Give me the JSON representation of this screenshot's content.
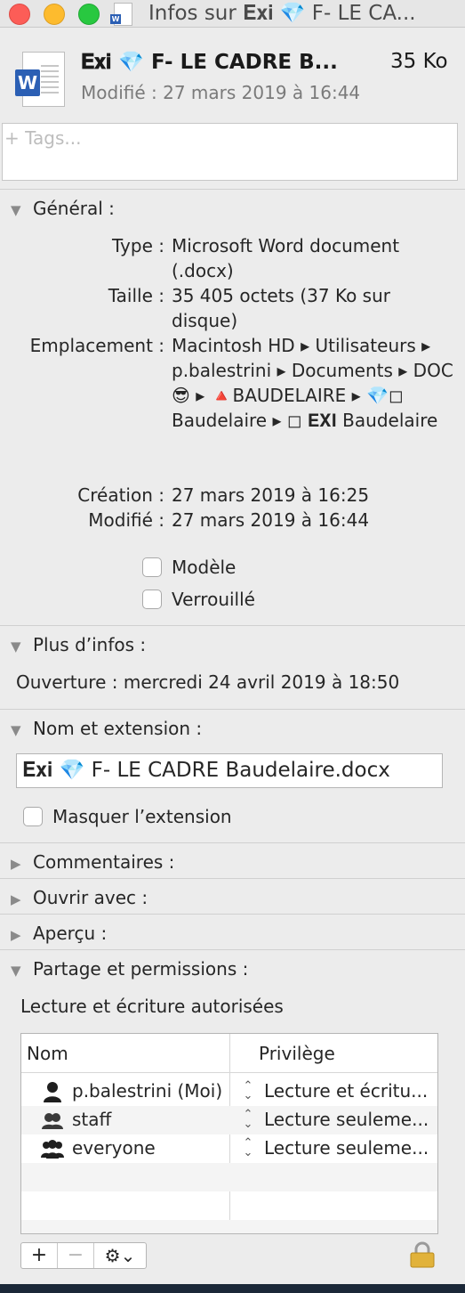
{
  "window": {
    "title": "Infos sur 𝐄𝐱𝐢 💎   F- LE CA..."
  },
  "file": {
    "name": "𝐄𝐱𝐢 💎   F- LE CADRE   B...",
    "size": "35 Ko",
    "modified": "Modifié : 27 mars 2019 à 16:44"
  },
  "tags": {
    "placeholder": "+ Tags..."
  },
  "general": {
    "header": "Général :",
    "type_label": "Type :",
    "type_value": "Microsoft Word document (.docx)",
    "size_label": "Taille :",
    "size_value": "35 405 octets (37 Ko sur disque)",
    "location_label": "Emplacement :",
    "location_value": "Macintosh HD ▸ Utilisateurs ▸ p.balestrini ▸ Documents ▸ DOC 😎 ▸ 🔺BAUDELAIRE ▸ 💎◻︎ Baudelaire ▸ ◻︎ 𝐄𝐗𝐈 Baudelaire",
    "created_label": "Création :",
    "created_value": "27 mars 2019 à 16:25",
    "modified_label": "Modifié :",
    "modified_value": "27 mars 2019 à 16:44",
    "template_label": "Modèle",
    "locked_label": "Verrouillé"
  },
  "more_info": {
    "header": "Plus d’infos :",
    "opened": "Ouverture : mercredi 24 avril 2019 à 18:50"
  },
  "name_ext": {
    "header": "Nom et extension :",
    "value": "𝐄𝐱𝐢 💎   F- LE CADRE   Baudelaire.docx",
    "hide_label": "Masquer l’extension"
  },
  "collapsed": {
    "comments": "Commentaires :",
    "open_with": "Ouvrir avec :",
    "preview": "Aperçu :"
  },
  "sharing": {
    "header": "Partage et permissions :",
    "status": "Lecture et écriture autorisées",
    "col_name": "Nom",
    "col_priv": "Privilège",
    "rows": [
      {
        "user": "p.balestrini (Moi)",
        "privilege": "Lecture et écritu..."
      },
      {
        "user": "staff",
        "privilege": "Lecture seuleme..."
      },
      {
        "user": "everyone",
        "privilege": "Lecture seuleme..."
      }
    ],
    "add": "+",
    "remove": "−",
    "action": "⚙︎⌄"
  },
  "colors": {
    "accent_word": "#2b5fb4",
    "window_bg": "#ececec"
  }
}
